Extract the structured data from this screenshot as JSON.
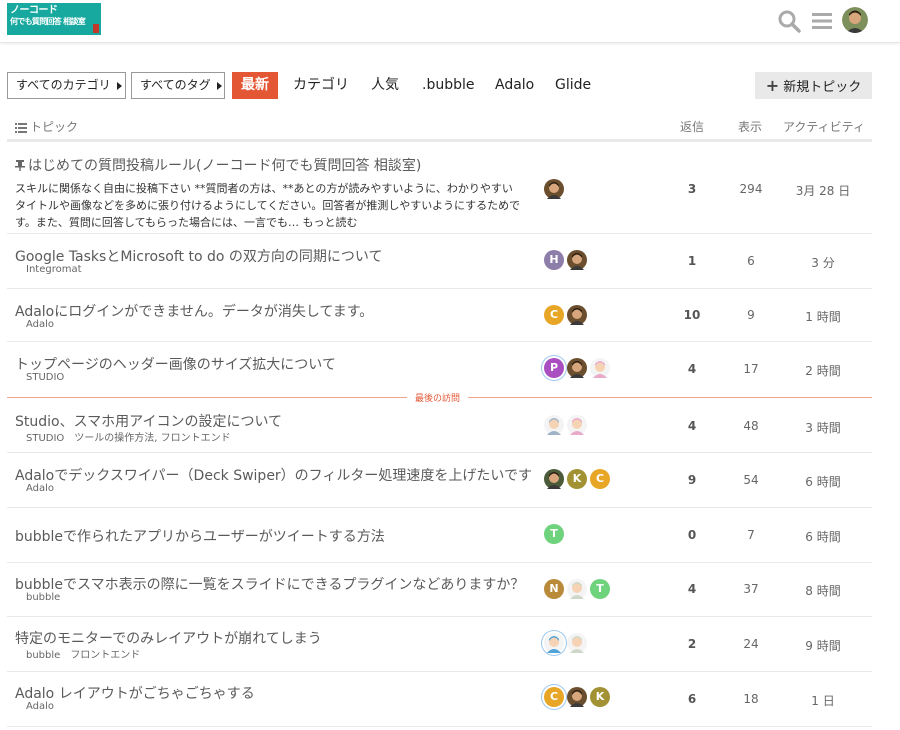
{
  "header": {
    "logo_line1": "ノーコード",
    "logo_line2": "何でも質問回答 相談室",
    "colors": {
      "accent": "#e45735",
      "logo_bg": "#17a9a0"
    }
  },
  "nav": {
    "category_dropdown": "すべてのカテゴリ",
    "tag_dropdown": "すべてのタグ",
    "items": [
      "最新",
      "カテゴリ",
      "人気",
      ".bubble",
      "Adalo",
      "Glide"
    ],
    "new_topic": "新規トピック"
  },
  "table_header": {
    "topic": "トピック",
    "replies": "返信",
    "views": "表示",
    "activity": "アクティビティ"
  },
  "last_visit_label": "最後の訪問",
  "topics": [
    {
      "title": "はじめての質問投稿ルール(ノーコード何でも質問回答 相談室)",
      "pinned": true,
      "excerpt": "スキルに関係なく自由に投稿下さい **質問者の方は、**あとの方が読みやすいように、わかりやすいタイトルや画像などを多めに張り付けるようにしてください。回答者が推測しやすいようにするためです。また、質問に回答してもらった場合には、一言でも…",
      "more": "もっと読む",
      "tags": [],
      "posters": [
        {
          "type": "photo",
          "color": "#6b4e2e"
        }
      ],
      "replies": "3",
      "views": "294",
      "activity": "3月 28 日"
    },
    {
      "title": "Google TasksとMicrosoft to do の双方向の同期について",
      "tags": [
        "Integromat"
      ],
      "posters": [
        {
          "type": "letter",
          "letter": "H",
          "color": "#8c7ea9"
        },
        {
          "type": "photo",
          "color": "#6b4e2e"
        }
      ],
      "replies": "1",
      "views": "6",
      "activity": "3 分"
    },
    {
      "title": "Adaloにログインができません。データが消失してます。",
      "tags": [
        "Adalo"
      ],
      "posters": [
        {
          "type": "letter",
          "letter": "C",
          "color": "#e8a627"
        },
        {
          "type": "photo",
          "color": "#6b4e2e"
        }
      ],
      "replies": "10",
      "views": "9",
      "activity": "1 時間"
    },
    {
      "title": "トップページのヘッダー画像のサイズ拡大について",
      "tags": [
        "STUDIO"
      ],
      "posters": [
        {
          "type": "letter",
          "letter": "P",
          "color": "#a94fc0",
          "ring": true
        },
        {
          "type": "photo",
          "color": "#6b4e2e"
        },
        {
          "type": "illustration",
          "color": "#e9a9c9"
        }
      ],
      "replies": "4",
      "views": "17",
      "activity": "2 時間"
    },
    {
      "title": "Studio、スマホ用アイコンの設定について",
      "tags": [
        "STUDIO",
        "ツールの操作方法",
        "フロントエンド"
      ],
      "tag_sep": ", ",
      "posters": [
        {
          "type": "illustration",
          "color": "#9fb3c8"
        },
        {
          "type": "illustration",
          "color": "#e9a9c9"
        }
      ],
      "replies": "4",
      "views": "48",
      "activity": "3 時間"
    },
    {
      "title": "Adaloでデックスワイパー（Deck Swiper）のフィルター処理速度を上げたいです",
      "tags": [
        "Adalo"
      ],
      "posters": [
        {
          "type": "photo",
          "color": "#4b5b3a"
        },
        {
          "type": "letter",
          "letter": "K",
          "color": "#a29233"
        },
        {
          "type": "letter",
          "letter": "C",
          "color": "#e8a627"
        }
      ],
      "replies": "9",
      "views": "54",
      "activity": "6 時間"
    },
    {
      "title": "bubbleで作られたアプリからユーザーがツイートする方法",
      "tags": [],
      "posters": [
        {
          "type": "letter",
          "letter": "T",
          "color": "#6ed37c"
        }
      ],
      "replies": "0",
      "views": "7",
      "activity": "6 時間"
    },
    {
      "title": "bubbleでスマホ表示の際に一覧をスライドにできるプラグインなどありますか？",
      "tags": [
        "bubble"
      ],
      "posters": [
        {
          "type": "letter",
          "letter": "N",
          "color": "#b88a3a"
        },
        {
          "type": "illustration",
          "color": "#cfd8c8"
        },
        {
          "type": "letter",
          "letter": "T",
          "color": "#6ed37c"
        }
      ],
      "replies": "4",
      "views": "37",
      "activity": "8 時間"
    },
    {
      "title": "特定のモニターでのみレイアウトが崩れてしまう",
      "tags": [
        "bubble",
        "フロントエンド"
      ],
      "posters": [
        {
          "type": "illustration",
          "color": "#4ea3d8",
          "ring": true
        },
        {
          "type": "illustration",
          "color": "#cfd8c8"
        }
      ],
      "replies": "2",
      "views": "24",
      "activity": "9 時間"
    },
    {
      "title": "Adalo レイアウトがごちゃごちゃする",
      "tags": [
        "Adalo"
      ],
      "posters": [
        {
          "type": "letter",
          "letter": "C",
          "color": "#e8a627",
          "ring": true
        },
        {
          "type": "photo",
          "color": "#6b4e2e"
        },
        {
          "type": "letter",
          "letter": "K",
          "color": "#a29233"
        }
      ],
      "replies": "6",
      "views": "18",
      "activity": "1 日"
    }
  ]
}
